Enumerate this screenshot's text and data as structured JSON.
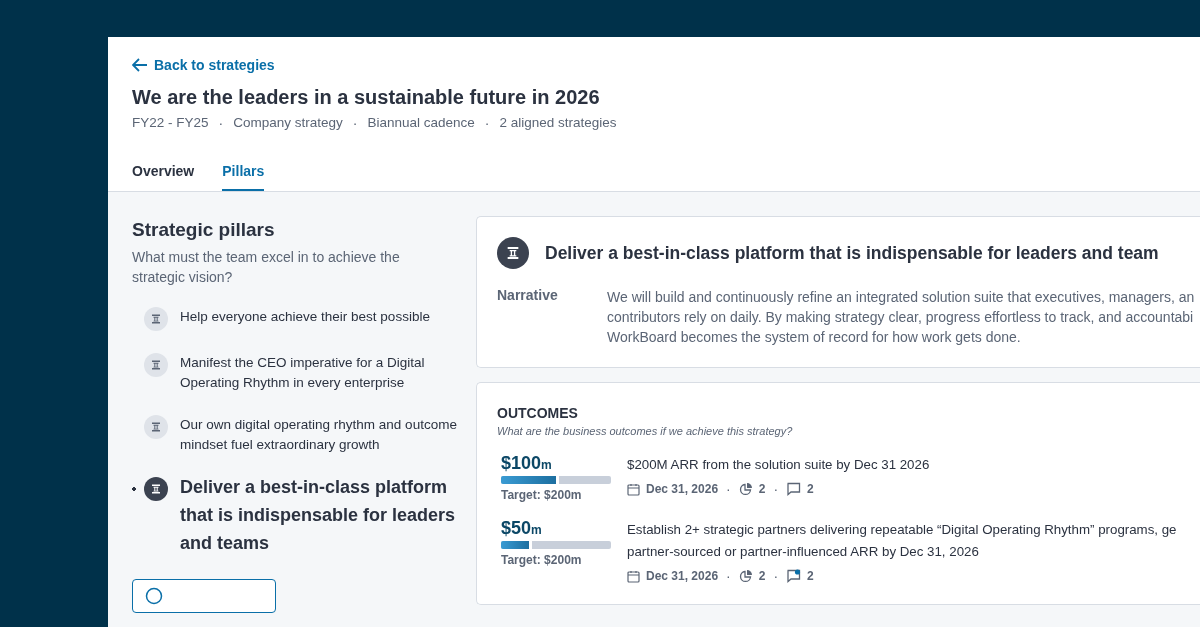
{
  "back_link": "Back to strategies",
  "separator": "·",
  "title": "We are the leaders in a sustainable future in 2026",
  "meta": [
    "FY22 - FY25",
    "Company strategy",
    "Biannual cadence",
    "2 aligned strategies"
  ],
  "tabs": [
    {
      "label": "Overview",
      "selected": false
    },
    {
      "label": "Pillars",
      "selected": true
    }
  ],
  "sidebar": {
    "title": "Strategic pillars",
    "subtitle": "What must the team excel in to achieve the strategic vision?",
    "items": [
      {
        "label": "Help everyone achieve their best possible",
        "selected": false
      },
      {
        "label": "Manifest the CEO imperative for a Digital Operating Rhythm in every enterprise",
        "selected": false
      },
      {
        "label": "Our own digital operating rhythm and outcome mindset fuel extraordinary growth",
        "selected": false
      },
      {
        "label": "Deliver a best-in-class platform that is indispensable for leaders and teams",
        "selected": true
      }
    ]
  },
  "pillar": {
    "title": "Deliver a best-in-class platform that is indispensable for leaders and team",
    "narrative_label": "Narrative",
    "narrative_lines": [
      "We will build and continuously refine an integrated solution suite that executives, managers, an",
      "contributors rely on daily. By making strategy clear, progress effortless to track, and accountabi",
      "WorkBoard becomes the system of record for how work gets done."
    ]
  },
  "outcomes": {
    "title": "OUTCOMES",
    "subtitle": "What are the business outcomes if we achieve this strategy?",
    "items": [
      {
        "value": "$100",
        "unit": "m",
        "level": 0.5,
        "target": "Target: $200m",
        "lines": [
          "$200M ARR from the solution suite by Dec 31 2026"
        ],
        "date": "Dec 31, 2026",
        "key_results": "2",
        "comments": "2",
        "unread": false
      },
      {
        "value": "$50",
        "unit": "m",
        "level": 0.25,
        "target": "Target: $200m",
        "lines": [
          "Establish 2+ strategic partners delivering repeatable “Digital Operating Rhythm” programs, ge",
          "partner-sourced or partner-influenced ARR by Dec 31, 2026"
        ],
        "date": "Dec 31, 2026",
        "key_results": "2",
        "comments": "2",
        "unread": true
      }
    ]
  }
}
